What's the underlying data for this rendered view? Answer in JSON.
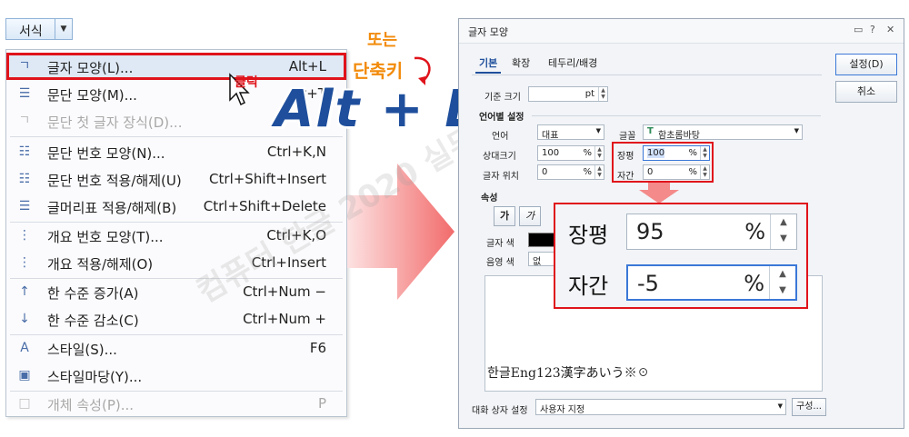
{
  "format_button": {
    "label": "서식"
  },
  "menu": {
    "items": [
      {
        "label": "글자 모양(L)...",
        "shortcut": "Alt+L",
        "icon": "char-shape-icon",
        "disabled": false
      },
      {
        "label": "문단 모양(M)...",
        "shortcut": "Alt+T",
        "icon": "paragraph-shape-icon",
        "disabled": false
      },
      {
        "label": "문단 첫 글자 장식(D)...",
        "shortcut": "",
        "icon": "drop-cap-icon",
        "disabled": true
      },
      {
        "label": "문단 번호 모양(N)...",
        "shortcut": "Ctrl+K,N",
        "icon": "numbering-shape-icon",
        "disabled": false
      },
      {
        "label": "문단 번호 적용/해제(U)",
        "shortcut": "Ctrl+Shift+Insert",
        "icon": "numbering-toggle-icon",
        "disabled": false
      },
      {
        "label": "글머리표 적용/해제(B)",
        "shortcut": "Ctrl+Shift+Delete",
        "icon": "bullet-toggle-icon",
        "disabled": false
      },
      {
        "label": "개요 번호 모양(T)...",
        "shortcut": "Ctrl+K,O",
        "icon": "outline-number-icon",
        "disabled": false
      },
      {
        "label": "개요 적용/해제(O)",
        "shortcut": "Ctrl+Insert",
        "icon": "outline-toggle-icon",
        "disabled": false
      },
      {
        "label": "한 수준 증가(A)",
        "shortcut": "Ctrl+Num −",
        "icon": "level-up-icon",
        "disabled": false
      },
      {
        "label": "한 수준 감소(C)",
        "shortcut": "Ctrl+Num +",
        "icon": "level-down-icon",
        "disabled": false
      },
      {
        "label": "스타일(S)...",
        "shortcut": "F6",
        "icon": "style-icon",
        "disabled": false
      },
      {
        "label": "스타일마당(Y)...",
        "shortcut": "",
        "icon": "style-gallery-icon",
        "disabled": false
      },
      {
        "label": "개체 속성(P)...",
        "shortcut": "P",
        "icon": "object-props-icon",
        "disabled": true
      }
    ]
  },
  "annotations": {
    "click": "클릭",
    "or": "또는",
    "shortcut_key": "단축키",
    "big_shortcut": "Alt + L",
    "watermark": "컴퓨터 한글 2020 실무"
  },
  "dialog": {
    "title": "글자 모양",
    "tabs": [
      "기본",
      "확장",
      "테두리/배경"
    ],
    "set_button": "설정(D)",
    "cancel_button": "취소",
    "base_size_label": "기준 크기",
    "base_size_unit": "pt",
    "lang_section": "언어별 설정",
    "lang_label": "언어",
    "lang_value": "대표",
    "font_label": "글꼴",
    "font_value": "함초롬바탕",
    "rel_size_label": "상대크기",
    "rel_size_value": "100",
    "pos_label": "글자 위치",
    "pos_value": "0",
    "width_label": "장평",
    "width_value": "100",
    "spacing_label": "자간",
    "spacing_value": "0",
    "percent": "%",
    "attr_section": "속성",
    "attr_buttons": [
      "가",
      "가"
    ],
    "text_color_label": "글자 색",
    "shade_color_label": "음영 색",
    "shade_value": "없",
    "preview_text": "한글Eng123漢字あいう※☉",
    "dialog_setting_label": "대화 상자 설정",
    "dialog_setting_value": "사용자 지정",
    "compose_button": "구성..."
  },
  "zoom": {
    "width_label": "장평",
    "width_value": "95",
    "spacing_label": "자간",
    "spacing_value": "-5",
    "percent": "%"
  },
  "colors": {
    "highlight_red": "#e0131b",
    "accent_orange": "#f28b0b",
    "alt_blue": "#1f4f9c",
    "focus_blue": "#3b78d8"
  }
}
